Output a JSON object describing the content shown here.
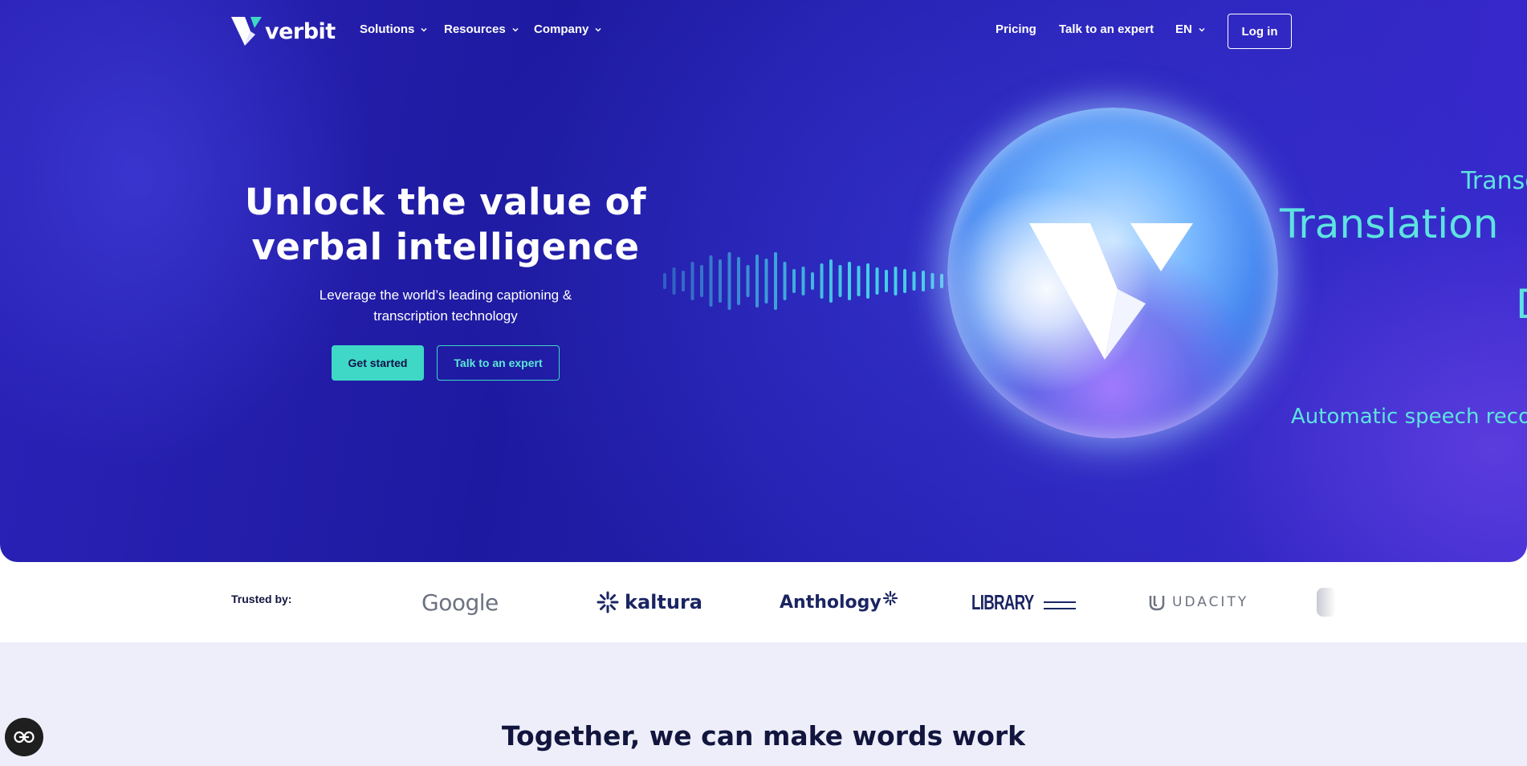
{
  "nav": {
    "logo_text": "verbit",
    "items": [
      {
        "label": "Solutions"
      },
      {
        "label": "Resources"
      },
      {
        "label": "Company"
      }
    ],
    "pricing": "Pricing",
    "talk": "Talk to an expert",
    "language": "EN",
    "login": "Log in"
  },
  "hero": {
    "title_line1": "Unlock the value of",
    "title_line2": "verbal intelligence",
    "subtitle_line1": "Leverage the world’s leading captioning &",
    "subtitle_line2": "transcription technology",
    "primary_cta": "Get started",
    "secondary_cta": "Talk to an expert",
    "floating_words": [
      "Translation",
      "Transc",
      "Automatic speech recogn",
      "D"
    ],
    "accent_color": "#3fd8c6"
  },
  "trusted": {
    "label": "Trusted by:",
    "partners": [
      "Google",
      "kaltura",
      "Anthology",
      "LIBRARY",
      "UDACITY"
    ]
  },
  "section": {
    "title": "Together, we can make words work"
  },
  "icons": [
    "verbit-logo-icon",
    "chevron-down-icon",
    "sound-wave-icon",
    "accessibility-icon"
  ]
}
